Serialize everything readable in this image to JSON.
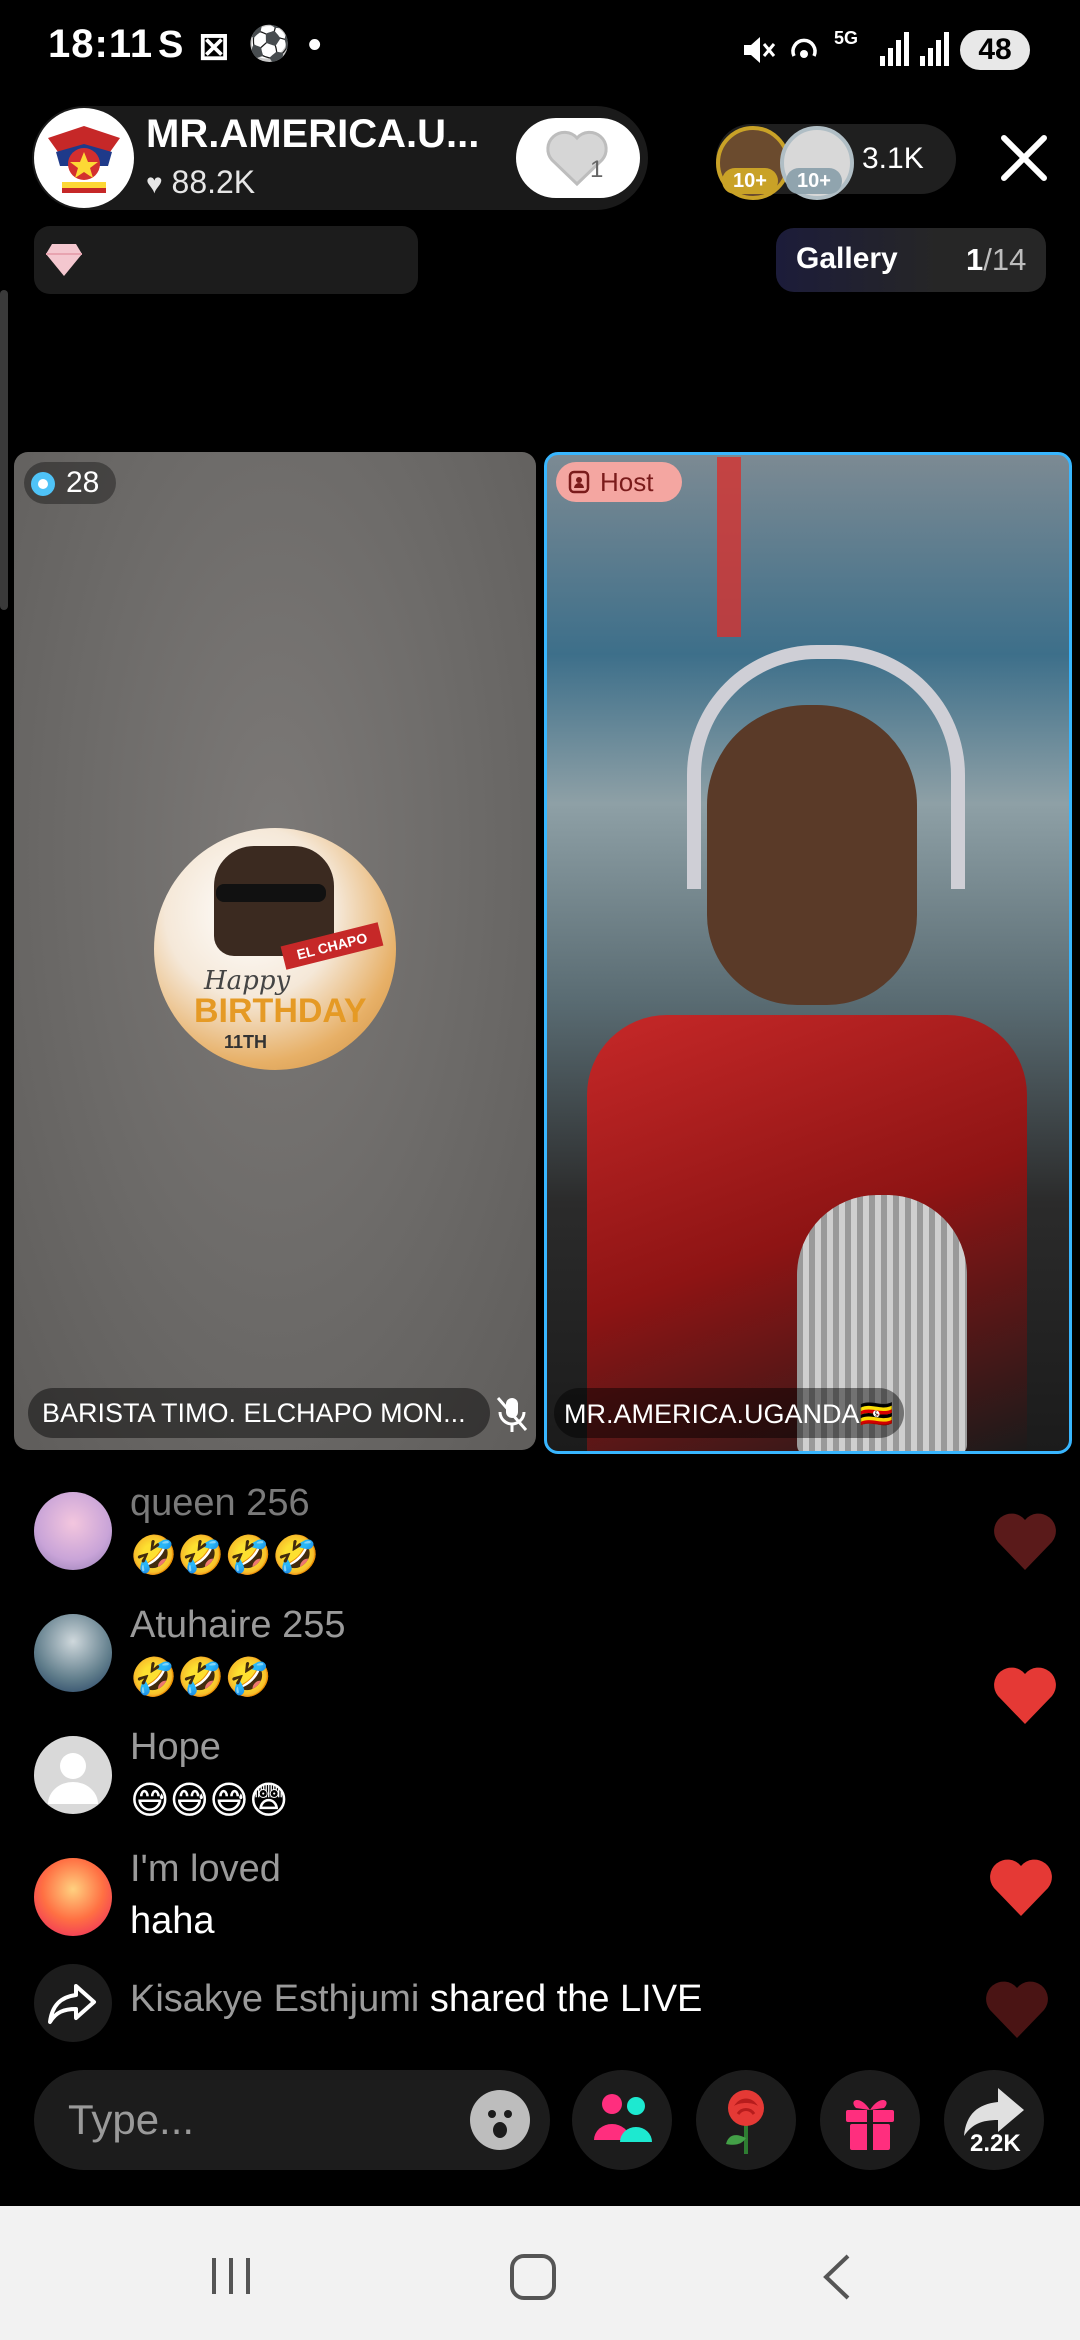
{
  "status_bar": {
    "time": "18:11",
    "app_icons": [
      "S",
      "⊠",
      "⚽",
      "•"
    ],
    "network": "5G",
    "battery": "48"
  },
  "header": {
    "host_name": "MR.AMERICA.U...",
    "likes": "88.2K",
    "follow_count": "1",
    "viewer_badges": [
      "10+",
      "10+"
    ],
    "viewer_count": "3.1K"
  },
  "gallery": {
    "label": "Gallery",
    "current": "1",
    "total": "/14"
  },
  "guest": {
    "count": "28",
    "name": "BARISTA TIMO. ELCHAPO MON...",
    "avatar_text": [
      "EL CHAPO",
      "Happy",
      "BIRTHDAY",
      "11TH"
    ]
  },
  "host": {
    "tag": "Host",
    "name": "MR.AMERICA.UGANDA🇺🇬"
  },
  "comments": [
    {
      "user": "queen 256",
      "text": "🤣🤣🤣🤣"
    },
    {
      "user": "Atuhaire 255",
      "text": "🤣🤣🤣"
    },
    {
      "user": "Hope",
      "text": "😅😅😅😨"
    },
    {
      "user": "I'm loved",
      "text": "haha"
    }
  ],
  "share_event": {
    "user": "Kisakye Esthjumi",
    "action": "shared the LIVE"
  },
  "bottom_bar": {
    "placeholder": "Type...",
    "share_count": "2.2K"
  },
  "colors": {
    "heart_red": "#e53935",
    "accent_blue": "#38b6ff",
    "pink": "#ff3d7f"
  }
}
